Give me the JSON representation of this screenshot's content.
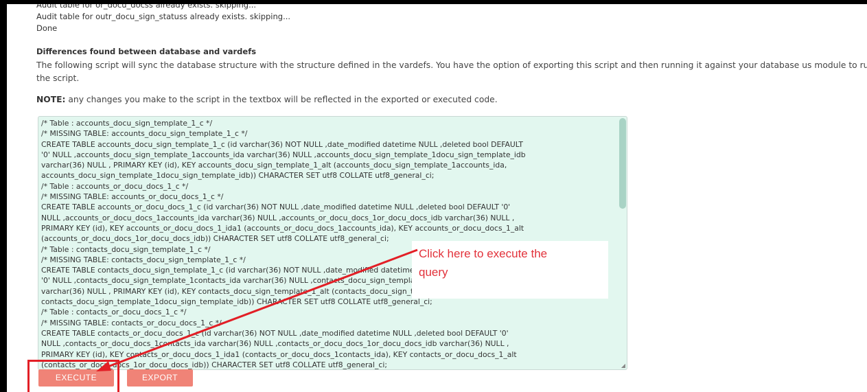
{
  "log": {
    "lines": [
      "Audit table for or_docu_docss already exists. skipping...",
      "Audit table for outr_docu_sign_statuss already exists. skipping...",
      "Done"
    ]
  },
  "section": {
    "heading": "Differences found between database and vardefs",
    "description": "The following script will sync the database structure with the structure defined in the vardefs. You have the option of exporting this script and then running it against your database us module to run the script.",
    "note_label": "NOTE:",
    "note_text": " any changes you make to the script in the textbox will be reflected in the exported or executed code."
  },
  "script": {
    "lines": [
      "/* Table : accounts_docu_sign_template_1_c */",
      "/* MISSING TABLE: accounts_docu_sign_template_1_c */",
      "CREATE TABLE accounts_docu_sign_template_1_c (id varchar(36)  NOT NULL ,date_modified datetime  NULL ,deleted bool  DEFAULT",
      "'0' NULL ,accounts_docu_sign_template_1accounts_ida varchar(36)  NULL ,accounts_docu_sign_template_1docu_sign_template_idb",
      "varchar(36)  NULL  , PRIMARY KEY (id),  KEY accounts_docu_sign_template_1_alt (accounts_docu_sign_template_1accounts_ida,",
      "accounts_docu_sign_template_1docu_sign_template_idb)) CHARACTER SET utf8 COLLATE utf8_general_ci;",
      "/* Table : accounts_or_docu_docs_1_c */",
      "/* MISSING TABLE: accounts_or_docu_docs_1_c */",
      "CREATE TABLE accounts_or_docu_docs_1_c (id varchar(36)  NOT NULL ,date_modified datetime  NULL ,deleted bool  DEFAULT '0'",
      "NULL ,accounts_or_docu_docs_1accounts_ida varchar(36)  NULL ,accounts_or_docu_docs_1or_docu_docs_idb varchar(36)  NULL  ,",
      "PRIMARY KEY (id),  KEY accounts_or_docu_docs_1_ida1 (accounts_or_docu_docs_1accounts_ida),  KEY accounts_or_docu_docs_1_alt",
      "(accounts_or_docu_docs_1or_docu_docs_idb)) CHARACTER SET utf8 COLLATE utf8_general_ci;",
      "/* Table : contacts_docu_sign_template_1_c */",
      "/* MISSING TABLE: contacts_docu_sign_template_1_c */",
      "CREATE TABLE contacts_docu_sign_template_1_c (id varchar(36)  NOT NULL ,date_modified datetime  NULL ,deleted bool  DEFAULT",
      "'0' NULL ,contacts_docu_sign_template_1contacts_ida varchar(36)  NULL ,contacts_docu_sign_template_1docu_sign_template_idb",
      "varchar(36)  NULL  , PRIMARY KEY (id),  KEY contacts_docu_sign_template_1_alt (contacts_docu_sign_template_1contacts_ida,",
      "contacts_docu_sign_template_1docu_sign_template_idb)) CHARACTER SET utf8 COLLATE utf8_general_ci;",
      "/* Table : contacts_or_docu_docs_1_c */",
      "/* MISSING TABLE: contacts_or_docu_docs_1_c */",
      "CREATE TABLE contacts_or_docu_docs_1_c (id varchar(36)  NOT NULL ,date_modified datetime  NULL ,deleted bool  DEFAULT '0'",
      "NULL ,contacts_or_docu_docs_1contacts_ida varchar(36)  NULL ,contacts_or_docu_docs_1or_docu_docs_idb varchar(36)  NULL  ,",
      "PRIMARY KEY (id),  KEY contacts_or_docu_docs_1_ida1 (contacts_or_docu_docs_1contacts_ida),  KEY contacts_or_docu_docs_1_alt",
      "(contacts_or_docu_docs_1or_docu_docs_idb)) CHARACTER SET utf8 COLLATE utf8_general_ci;"
    ]
  },
  "buttons": {
    "execute_label": "EXECUTE",
    "export_label": "EXPORT"
  },
  "annotation": {
    "callout_text": "Click here to execute the\nquery",
    "color": "#e21f26"
  },
  "colors": {
    "button": "#f08377",
    "textarea_bg": "#e2f7ef",
    "scroll_thumb": "#a9d3c5"
  }
}
